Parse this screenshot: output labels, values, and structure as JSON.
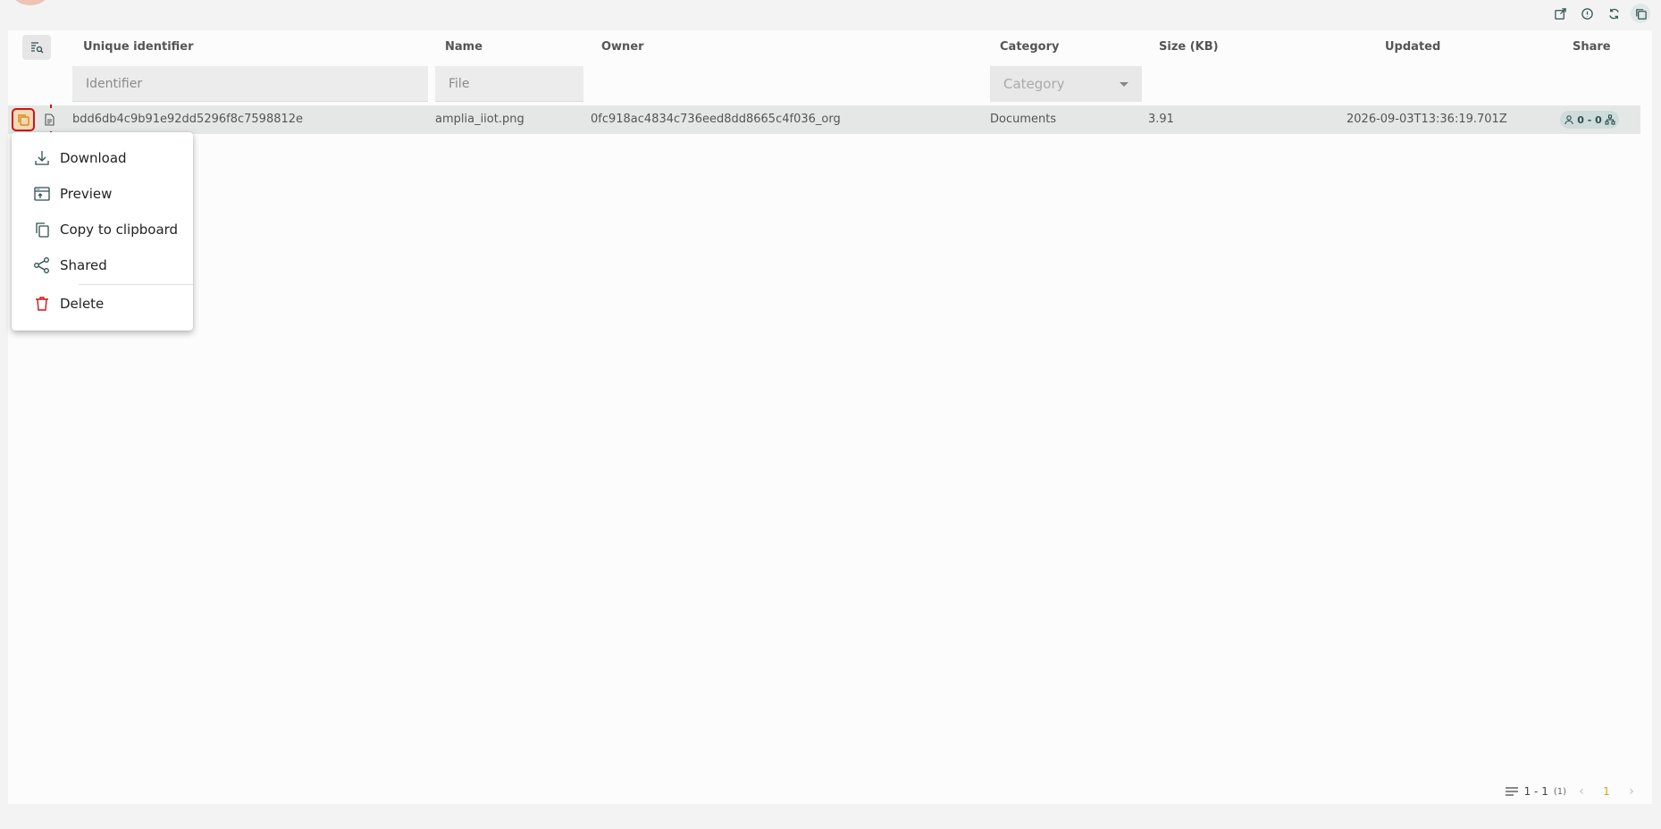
{
  "toolbar": {
    "buttons": [
      {
        "icon": "export-icon"
      },
      {
        "icon": "info-icon"
      },
      {
        "icon": "refresh-icon"
      },
      {
        "icon": "copy-layout-icon"
      }
    ]
  },
  "table": {
    "headers": {
      "identifier": "Unique identifier",
      "name": "Name",
      "owner": "Owner",
      "category": "Category",
      "size": "Size (KB)",
      "updated": "Updated",
      "share": "Share"
    },
    "filters": {
      "identifier_placeholder": "Identifier",
      "file_placeholder": "File",
      "category_placeholder": "Category"
    },
    "rows": [
      {
        "identifier": "bdd6db4c9b91e92dd5296f8c7598812e",
        "name": "amplia_iiot.png",
        "owner": "0fc918ac4834c736eed8dd8665c4f036_org",
        "category": "Documents",
        "size": "3.91",
        "updated": "2026-09-03T13:36:19.701Z",
        "share": "0 - 0"
      }
    ]
  },
  "context_menu": {
    "items": [
      {
        "label": "Download",
        "icon": "download-icon"
      },
      {
        "label": "Preview",
        "icon": "preview-icon"
      },
      {
        "label": "Copy to clipboard",
        "icon": "copy-icon"
      },
      {
        "label": "Shared",
        "icon": "share-icon"
      },
      {
        "label": "Delete",
        "icon": "trash-icon"
      }
    ]
  },
  "pagination": {
    "range": "1 - 1",
    "total": "(1)",
    "current_page": "1"
  },
  "colors": {
    "accent": "#d4a017",
    "danger": "#d21414",
    "icon": "#2f4f4f"
  }
}
